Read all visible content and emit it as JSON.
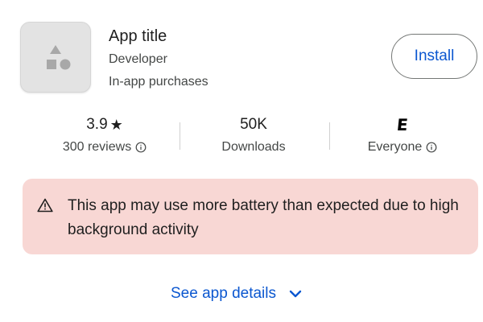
{
  "app": {
    "title": "App title",
    "developer": "Developer",
    "in_app_purchases": "In-app purchases",
    "icon": "app-placeholder-shapes-icon"
  },
  "install_button": {
    "label": "Install"
  },
  "stats": {
    "rating": {
      "value": "3.9",
      "star_icon": "★",
      "label": "300 reviews",
      "info_icon": "info-icon"
    },
    "downloads": {
      "value": "50K",
      "label": "Downloads"
    },
    "content_rating": {
      "badge": "E",
      "label": "Everyone",
      "info_icon": "info-icon"
    }
  },
  "warning": {
    "icon": "warning-triangle-icon",
    "text": "This app may use more battery than expected due to high background activity",
    "background_color": "#f8d7d4"
  },
  "details_link": {
    "label": "See app details",
    "icon": "chevron-down-icon"
  },
  "colors": {
    "accent": "#0b57d0",
    "text_primary": "#1f1f1f",
    "text_secondary": "#444746"
  }
}
